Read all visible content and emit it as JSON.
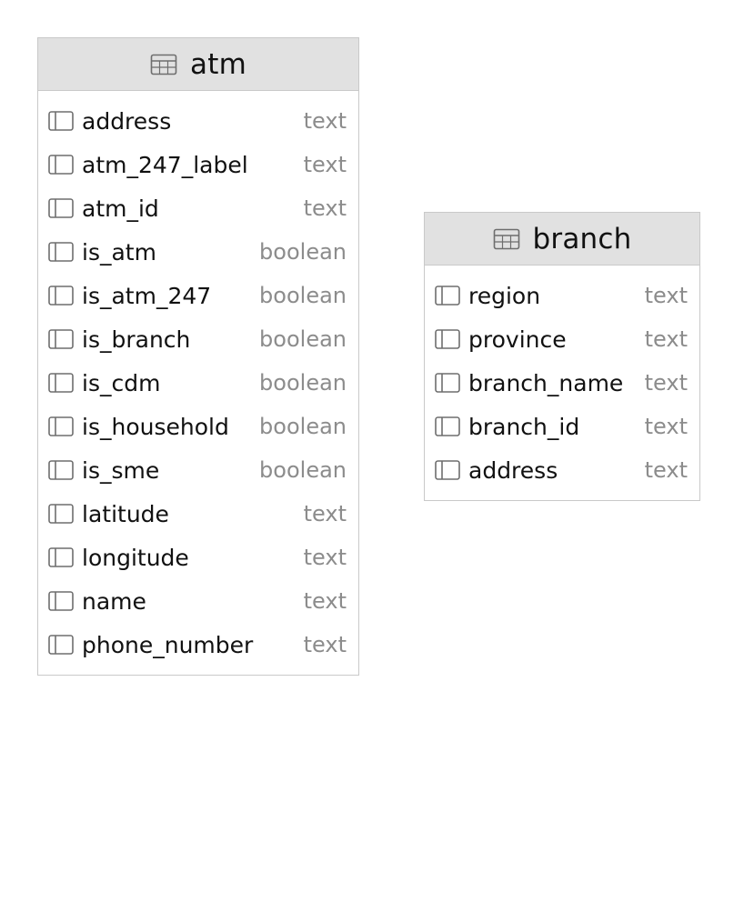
{
  "tables": [
    {
      "name": "atm",
      "icon": "table-icon",
      "columns": [
        {
          "name": "address",
          "type": "text"
        },
        {
          "name": "atm_247_label",
          "type": "text"
        },
        {
          "name": "atm_id",
          "type": "text"
        },
        {
          "name": "is_atm",
          "type": "boolean"
        },
        {
          "name": "is_atm_247",
          "type": "boolean"
        },
        {
          "name": "is_branch",
          "type": "boolean"
        },
        {
          "name": "is_cdm",
          "type": "boolean"
        },
        {
          "name": "is_household",
          "type": "boolean"
        },
        {
          "name": "is_sme",
          "type": "boolean"
        },
        {
          "name": "latitude",
          "type": "text"
        },
        {
          "name": "longitude",
          "type": "text"
        },
        {
          "name": "name",
          "type": "text"
        },
        {
          "name": "phone_number",
          "type": "text"
        }
      ]
    },
    {
      "name": "branch",
      "icon": "table-icon",
      "columns": [
        {
          "name": "region",
          "type": "text"
        },
        {
          "name": "province",
          "type": "text"
        },
        {
          "name": "branch_name",
          "type": "text"
        },
        {
          "name": "branch_id",
          "type": "text"
        },
        {
          "name": "address",
          "type": "text"
        }
      ]
    }
  ],
  "colors": {
    "header_bg": "#e1e1e1",
    "border": "#c9c9c9",
    "text": "#111111",
    "type_text": "#8c8c8c",
    "icon_stroke": "#6e6e6e"
  }
}
